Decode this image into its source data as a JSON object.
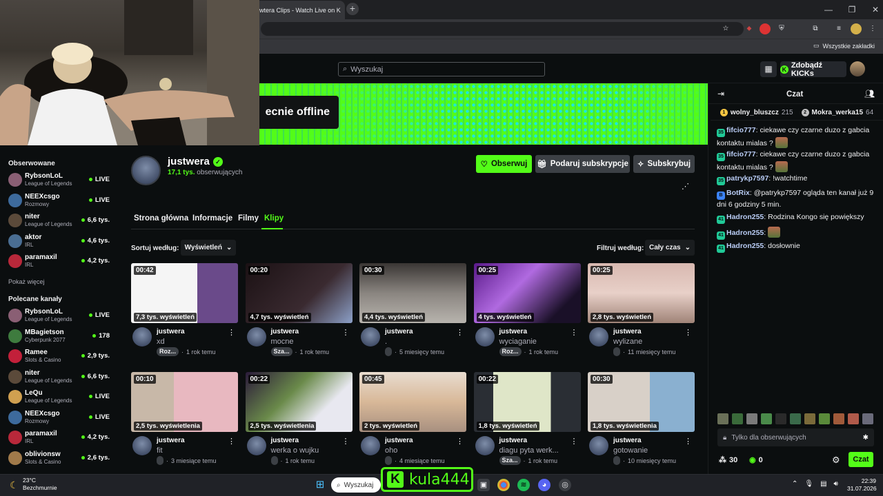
{
  "browser": {
    "tab_title": "wtera Clips - Watch Live on K",
    "new_tab": "+",
    "bookmarks_label": "Wszystkie zakładki"
  },
  "header": {
    "search_placeholder": "Wyszukaj",
    "kicks_button": "Zdobądź KICKs"
  },
  "banner": {
    "offline_text": "ecnie offline"
  },
  "sidebar": {
    "following_title": "Obserwowane",
    "following": [
      {
        "name": "RybsonLoL",
        "sub": "League of Legends",
        "status": "LIVE",
        "color": "#8a5f74"
      },
      {
        "name": "NEEXcsgo",
        "sub": "Rozmowy",
        "status": "LIVE",
        "color": "#3d6a9c"
      },
      {
        "name": "niter",
        "sub": "League of Legends",
        "status": "6,6 tys.",
        "color": "#5b4a3a"
      },
      {
        "name": "aktor",
        "sub": "IRL",
        "status": "4,6 tys.",
        "color": "#4a6e93"
      },
      {
        "name": "paramaxil",
        "sub": "IRL",
        "status": "4,2 tys.",
        "color": "#b8283a"
      }
    ],
    "show_more": "Pokaż więcej",
    "recommended_title": "Polecane kanały",
    "recommended": [
      {
        "name": "RybsonLoL",
        "sub": "League of Legends",
        "status": "LIVE",
        "color": "#8a5f74"
      },
      {
        "name": "MBagietson",
        "sub": "Cyberpunk 2077",
        "status": "178",
        "color": "#3e7b3e"
      },
      {
        "name": "Ramee",
        "sub": "Slots & Casino",
        "status": "2,9 tys.",
        "color": "#c2203a"
      },
      {
        "name": "niter",
        "sub": "League of Legends",
        "status": "6,6 tys.",
        "color": "#5b4a3a"
      },
      {
        "name": "LeQu",
        "sub": "League of Legends",
        "status": "LIVE",
        "color": "#d0a050"
      },
      {
        "name": "NEEXcsgo",
        "sub": "Rozmowy",
        "status": "LIVE",
        "color": "#3d6a9c"
      },
      {
        "name": "paramaxil",
        "sub": "IRL",
        "status": "4,2 tys.",
        "color": "#b8283a"
      },
      {
        "name": "oblivionsw",
        "sub": "Slots & Casino",
        "status": "2,6 tys.",
        "color": "#a07a4a"
      }
    ]
  },
  "channel": {
    "name": "justwera",
    "followers_count": "17,1 tys.",
    "followers_label": "obserwujących",
    "follow_button": "Obserwuj",
    "gift_button": "Podaruj subskrypcje",
    "subscribe_button": "Subskrybuj"
  },
  "tabs": {
    "home": "Strona główna",
    "about": "Informacje",
    "videos": "Filmy",
    "clips": "Klipy"
  },
  "controls": {
    "sort_label": "Sortuj według:",
    "sort_value": "Wyświetleń",
    "filter_label": "Filtruj według:",
    "filter_value": "Cały czas"
  },
  "clips": [
    {
      "duration": "00:42",
      "views": "7,3 tys. wyświetleń",
      "user": "justwera",
      "title": "xd",
      "tag": "Roz...",
      "age": "1 rok temu",
      "thumb": "linear-gradient(90deg,#f5f5f5 0 62%,#6a4a8a 62% 100%)"
    },
    {
      "duration": "00:20",
      "views": "4,7 tys. wyświetleń",
      "user": "justwera",
      "title": "mocne",
      "tag": "Sza...",
      "age": "1 rok temu",
      "thumb": "linear-gradient(135deg,#1b1114,#3a2a30 60%,#8ca0c8)"
    },
    {
      "duration": "00:30",
      "views": "4,4 tys. wyświetleń",
      "user": "justwera",
      "title": ".",
      "tag": "",
      "age": "5 miesięcy temu",
      "thumb": "linear-gradient(180deg,#3a3634,#8a8580 50%,#b8b4ae)"
    },
    {
      "duration": "00:25",
      "views": "4 tys. wyświetleń",
      "user": "justwera",
      "title": "wyciaganie",
      "tag": "Roz...",
      "age": "1 rok temu",
      "thumb": "linear-gradient(135deg,#5a1a8a,#b06ae0 40%,#1a1028 80%)"
    },
    {
      "duration": "00:25",
      "views": "2,8 tys. wyświetleń",
      "user": "justwera",
      "title": "wylizane",
      "tag": "",
      "age": "11 miesięcy temu",
      "thumb": "linear-gradient(180deg,#d8b8b0,#e8d0c8 50%,#a08478)"
    },
    {
      "duration": "00:10",
      "views": "2,5 tys. wyświetlenia",
      "user": "justwera",
      "title": "fit",
      "tag": "",
      "age": "3 miesiące temu",
      "thumb": "linear-gradient(90deg,#c8b8a8 0 40%,#e8b8c0 40% 100%)"
    },
    {
      "duration": "00:22",
      "views": "2,5 tys. wyświetlenia",
      "user": "justwera",
      "title": "werka o wujku",
      "tag": "",
      "age": "1 rok temu",
      "thumb": "linear-gradient(135deg,#2a1a3a,#6a8a4a 40%,#e8e8f0 70%)"
    },
    {
      "duration": "00:45",
      "views": "2 tys. wyświetleń",
      "user": "justwera",
      "title": "oho",
      "tag": "",
      "age": "4 miesiące temu",
      "thumb": "linear-gradient(180deg,#e8dcd0,#d8b898 50%,#a89080)"
    },
    {
      "duration": "00:22",
      "views": "1,8 tys. wyświetleń",
      "user": "justwera",
      "title": "diagu pyta werk...",
      "tag": "Sza...",
      "age": "1 rok temu",
      "thumb": "linear-gradient(90deg,#2a2e34 0 18%,#dfe6c8 18% 72%,#2a2e34 72%)"
    },
    {
      "duration": "00:30",
      "views": "1,8 tys. wyświetlenia",
      "user": "justwera",
      "title": "gotowanie",
      "tag": "",
      "age": "10 miesięcy temu",
      "thumb": "linear-gradient(90deg,#d8d0c8 0 58%,#8ab0d0 58%)"
    }
  ],
  "chat": {
    "title": "Czat",
    "leaderboard": [
      {
        "rank": "1",
        "name": "wolny_bluszcz",
        "count": "215",
        "color": "#f5c542"
      },
      {
        "rank": "2",
        "name": "Mokra_werka15",
        "count": "64",
        "color": "#c0c0c0"
      }
    ],
    "messages": [
      {
        "badge": "35",
        "user": "fifcio777",
        "text": "ciekawe czy czarne duzo z gabcia kontaktu mialas ?",
        "emote": true
      },
      {
        "badge": "35",
        "user": "fifcio777",
        "text": "ciekawe czy czarne duzo z gabcia kontaktu mialas ?",
        "emote": true
      },
      {
        "badge": "35",
        "user": "patrykp7597",
        "text": "!watchtime",
        "emote": false
      },
      {
        "badge": "B",
        "user": "BotRix",
        "text": "@patrykp7597 ogląda ten kanał już 9 dni 6 godziny 5 min.",
        "emote": false
      },
      {
        "badge": "41",
        "user": "Hadron255",
        "text": "Rodzina Kongo się powiększy",
        "emote": false
      },
      {
        "badge": "41",
        "user": "Hadron255",
        "text": "",
        "emote": true
      },
      {
        "badge": "41",
        "user": "Hadron255",
        "text": "dosłownie",
        "emote": false
      }
    ],
    "input_placeholder": "Tylko dla obserwujących",
    "kicks": "30",
    "points": "0",
    "send_button": "Czat"
  },
  "taskbar": {
    "temperature": "23°C",
    "weather": "Bezchmurnie",
    "search": "Wyszukaj",
    "overlay_name": "kula444",
    "time": "22:39",
    "date": "31.07.2026"
  }
}
